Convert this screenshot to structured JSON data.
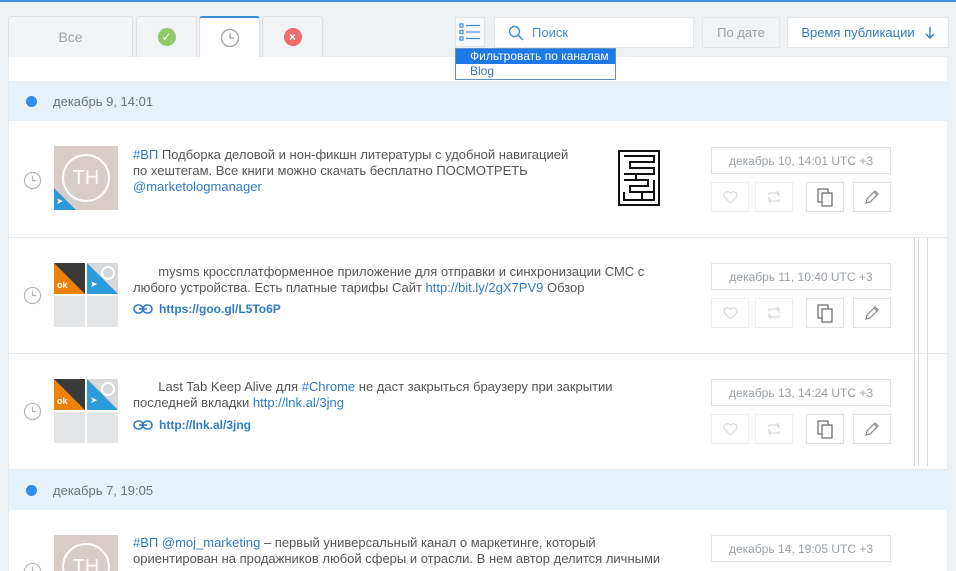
{
  "tabs": [
    {
      "label": "Все",
      "icon": "",
      "active": false
    },
    {
      "label": "",
      "icon": "check-icon",
      "active": false
    },
    {
      "label": "",
      "icon": "clock-icon",
      "active": true
    },
    {
      "label": "",
      "icon": "x-icon",
      "active": false
    }
  ],
  "toolbar": {
    "search_placeholder": "Поиск",
    "date_button": "По дате",
    "sort_button": "Время публикации"
  },
  "dropdown": {
    "options": [
      "Фильтровать по каналам",
      "Blog"
    ],
    "selected_index": 0
  },
  "groups": [
    {
      "label": "декабрь 9, 14:01"
    },
    {
      "label": "декабрь 7, 19:05"
    }
  ],
  "posts": [
    {
      "avatar_initials": "TH",
      "text": {
        "tag": "#ВП",
        "body": " Подборка деловой и нон-фикшн литературы с удобной навигацией по хештегам. Все книги можно скачать бесплатно ПОСМОТРЕТЬ ",
        "mention": "@marketologmanager"
      },
      "date": "декабрь 10, 14:01 UTC +3"
    },
    {
      "text": {
        "body": "       mysms кроссплатформенное приложение для отправки и синхронизации СМС с любого устройства. Есть платные тарифы Сайт ",
        "link": "http://bit.ly/2gX7PV9",
        "after": " Обзор"
      },
      "short_link": "https://goo.gl/L5To6P",
      "date": "декабрь 11, 10:40 UTC +3"
    },
    {
      "text": {
        "body": "       Last Tab Keep Alive для ",
        "tag": "#Chrome",
        "after": " не даст закрыться браузеру при закрытии последней вкладки ",
        "link": "http://lnk.al/3jng"
      },
      "short_link": "http://lnk.al/3jng",
      "date": "декабрь 13, 14:24 UTC +3"
    },
    {
      "avatar_initials": "TH",
      "text": {
        "tag": "#ВП",
        "mention": "@moj_marketing",
        "body": " – первый универсальный канал о маркетинге, который ориентирован на продажников любой сферы и отрасли. В нем автор делится личными"
      },
      "date": "декабрь 14, 19:05 UTC +3"
    }
  ],
  "colors": {
    "accent": "#2f7cc5",
    "group_bg": "#e7f1f9",
    "dot": "#2f8fe4",
    "ok": "#8fcb6a",
    "cancel": "#f06b6b"
  }
}
